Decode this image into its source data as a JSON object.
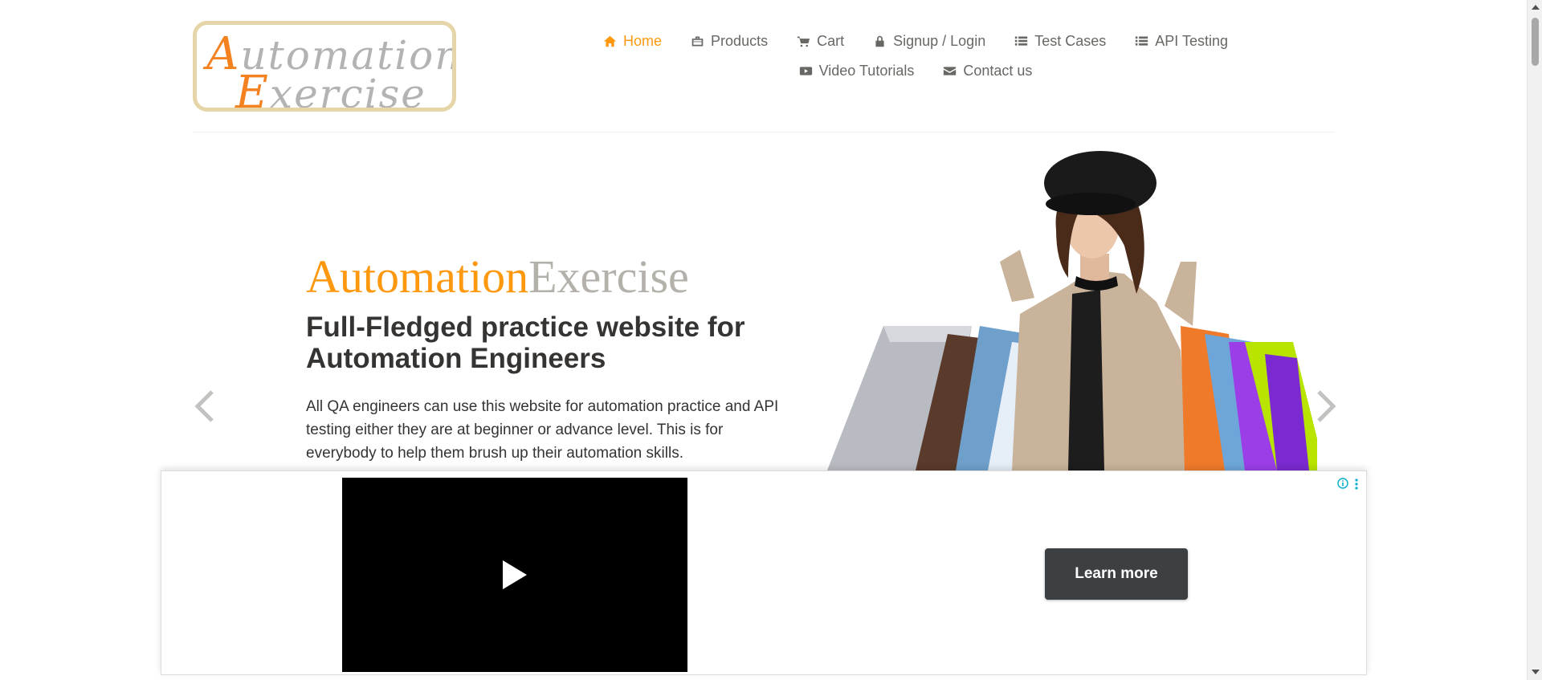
{
  "logo": {
    "line1": "Automation",
    "line2": "Exercise"
  },
  "nav": {
    "items": [
      {
        "label": "Home",
        "icon": "home-icon",
        "active": true
      },
      {
        "label": "Products",
        "icon": "briefcase-icon"
      },
      {
        "label": "Cart",
        "icon": "cart-icon"
      },
      {
        "label": "Signup / Login",
        "icon": "lock-icon"
      },
      {
        "label": "Test Cases",
        "icon": "list-icon"
      },
      {
        "label": "API Testing",
        "icon": "list-icon"
      },
      {
        "label": "Video Tutorials",
        "icon": "youtube-play-icon"
      },
      {
        "label": "Contact us",
        "icon": "envelope-icon"
      }
    ]
  },
  "hero": {
    "title_part1": "Automation",
    "title_part2": "Exercise",
    "subtitle": "Full-Fledged practice website for Automation Engineers",
    "description": "All QA engineers can use this website for automation practice and API testing either they are at beginner or advance level. This is for everybody to help them brush up their automation skills."
  },
  "ad": {
    "cta_label": "Learn more"
  },
  "colors": {
    "accent": "#fe980f",
    "nav_text": "#696763",
    "title_grey": "#b4b1ab",
    "cta_bg": "#3c4043"
  }
}
